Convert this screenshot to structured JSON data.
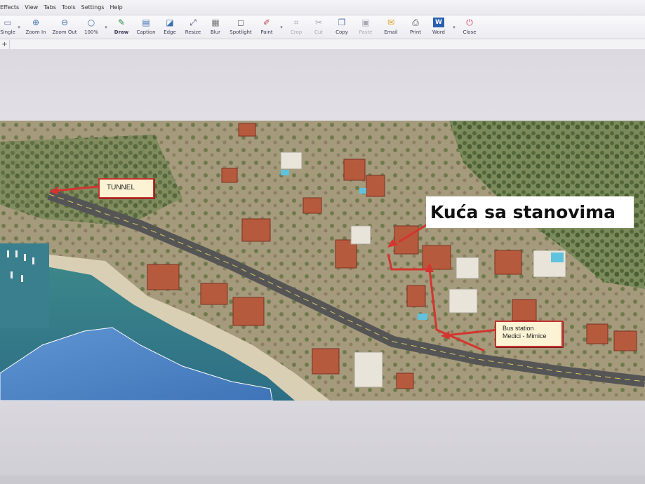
{
  "menu": [
    "Effects",
    "View",
    "Tabs",
    "Tools",
    "Settings",
    "Help"
  ],
  "toolbar": {
    "items": [
      {
        "label": "Single",
        "icon": "layout-icon",
        "dim": false
      },
      {
        "label": "Zoom In",
        "icon": "zoom-in-icon",
        "dim": false
      },
      {
        "label": "Zoom Out",
        "icon": "zoom-out-icon",
        "dim": false
      },
      {
        "label": "100%",
        "icon": "zoom-100-icon",
        "dim": false
      },
      {
        "label": "Draw",
        "icon": "draw-icon",
        "dim": false
      },
      {
        "label": "Caption",
        "icon": "caption-icon",
        "dim": false
      },
      {
        "label": "Edge",
        "icon": "edge-icon",
        "dim": false
      },
      {
        "label": "Resize",
        "icon": "resize-icon",
        "dim": false
      },
      {
        "label": "Blur",
        "icon": "blur-icon",
        "dim": false
      },
      {
        "label": "Spotlight",
        "icon": "spotlight-icon",
        "dim": false
      },
      {
        "label": "Paint",
        "icon": "paint-icon",
        "dim": false
      },
      {
        "label": "Crop",
        "icon": "crop-icon",
        "dim": true
      },
      {
        "label": "Cut",
        "icon": "cut-icon",
        "dim": true
      },
      {
        "label": "Copy",
        "icon": "copy-icon",
        "dim": false
      },
      {
        "label": "Paste",
        "icon": "paste-icon",
        "dim": true
      },
      {
        "label": "Email",
        "icon": "email-icon",
        "dim": false
      },
      {
        "label": "Print",
        "icon": "print-icon",
        "dim": false
      },
      {
        "label": "Word",
        "icon": "word-icon",
        "dim": false
      },
      {
        "label": "Close",
        "icon": "close-icon",
        "dim": false
      }
    ]
  },
  "tabs": {
    "add": "+"
  },
  "annotations": {
    "tunnel": "TUNNEL",
    "bus_line1": "Bus station",
    "bus_line2": "Medici - Mimice",
    "house": "Kuća sa stanovima"
  },
  "colors": {
    "arrow": "#d4352f",
    "label_bg": "#fbf3d3",
    "sea": "#4f8fc4"
  }
}
